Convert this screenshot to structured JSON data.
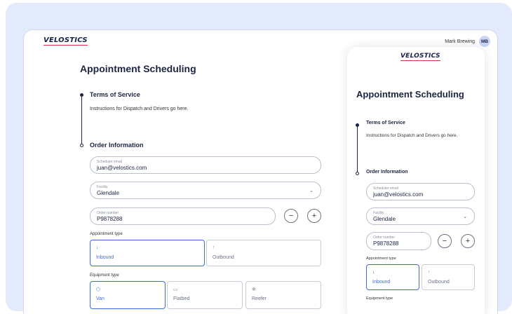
{
  "brand": {
    "logo": "VELOSTICS",
    "accent": "#e0314b"
  },
  "user": {
    "name": "Mark Brewing",
    "initials": "MB"
  },
  "page": {
    "title": "Appointment Scheduling"
  },
  "terms": {
    "title": "Terms of Service",
    "text": "Instructions for Dispatch and Drivers go here."
  },
  "order": {
    "title": "Order Information",
    "email": {
      "label": "Scheduler email",
      "value": "juan@velostics.com"
    },
    "facility": {
      "label": "Facility",
      "value": "Glendale"
    },
    "order_number": {
      "label": "Order number",
      "value": "P9878288"
    }
  },
  "appointment_type": {
    "label": "Appointment type",
    "options": [
      {
        "label": "Inbound",
        "icon": "↓"
      },
      {
        "label": "Outbound",
        "icon": "↑"
      }
    ],
    "selected": "Inbound"
  },
  "equipment_type": {
    "label": "Equipment type",
    "options": [
      {
        "label": "Van",
        "icon": "⬡"
      },
      {
        "label": "Flatbed",
        "icon": "▭"
      },
      {
        "label": "Reefer",
        "icon": "✻"
      }
    ],
    "selected": "Van"
  },
  "stepper": {
    "minus": "−",
    "plus": "+"
  },
  "colors": {
    "primary": "#1c2541",
    "selected": "#3d6cd9",
    "background": "#e3eafb"
  }
}
